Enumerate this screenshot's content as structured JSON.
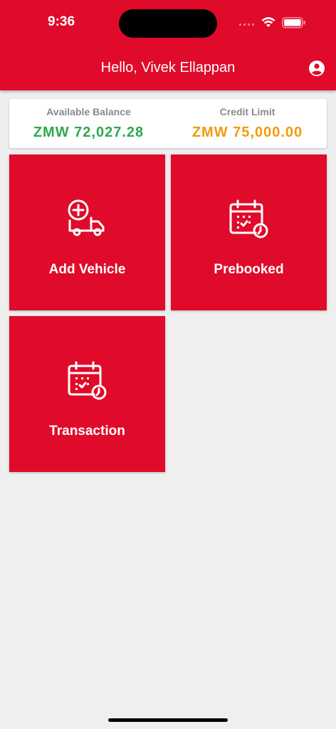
{
  "status_bar": {
    "time": "9:36",
    "wifi_icon": "wifi-icon",
    "battery_icon": "battery-icon"
  },
  "header": {
    "greeting": "Hello, Vivek Ellappan",
    "profile_icon": "account-circle-icon"
  },
  "balance": {
    "available_label": "Available Balance",
    "available_value": "ZMW 72,027.28",
    "credit_label": "Credit Limit",
    "credit_value": "ZMW 75,000.00"
  },
  "tiles": [
    {
      "label": "Add Vehicle",
      "icon": "add-truck-icon"
    },
    {
      "label": "Prebooked",
      "icon": "calendar-clock-icon"
    },
    {
      "label": "Transaction",
      "icon": "calendar-clock-icon"
    }
  ],
  "colors": {
    "primary": "#e00b2a",
    "background": "#efefef",
    "balance_green": "#2fa84a",
    "credit_orange": "#f29a0d",
    "label_gray": "#8a8a8a"
  }
}
